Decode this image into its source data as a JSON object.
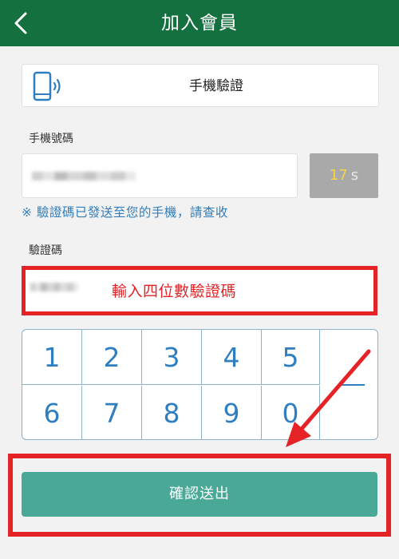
{
  "header": {
    "title": "加入會員"
  },
  "verification": {
    "method_label": "手機驗證"
  },
  "phone": {
    "label": "手機號碼",
    "timer_value": "17",
    "timer_unit": "s"
  },
  "notice": "※ 驗證碼已發送至您的手機，請查收",
  "code": {
    "label": "驗證碼",
    "hint": "輸入四位數驗證碼"
  },
  "keypad": {
    "keys": [
      "1",
      "2",
      "3",
      "4",
      "5",
      "6",
      "7",
      "8",
      "9",
      "0"
    ]
  },
  "submit": {
    "label": "確認送出"
  },
  "colors": {
    "header": "#14703f",
    "accent": "#2f7fc0",
    "highlight": "#e52225",
    "submit": "#4aa996"
  }
}
